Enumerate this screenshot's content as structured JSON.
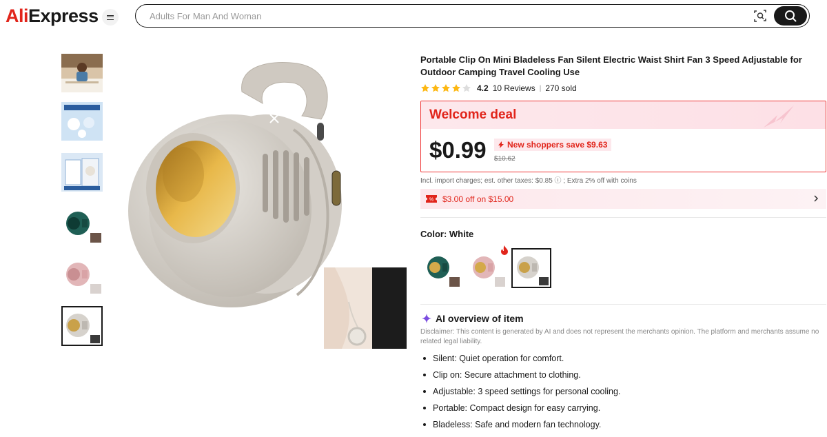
{
  "header": {
    "logo_prefix": "Ali",
    "logo_suffix": "Express",
    "search_placeholder": "Adults For Man And Woman"
  },
  "gallery": {
    "thumbnails": [
      {
        "name": "thumb-woman-at-desk",
        "selected": false
      },
      {
        "name": "thumb-infographic",
        "selected": false
      },
      {
        "name": "thumb-package",
        "selected": false
      },
      {
        "name": "thumb-green-fan",
        "selected": false
      },
      {
        "name": "thumb-pink-fan",
        "selected": false
      },
      {
        "name": "thumb-white-fan",
        "selected": true
      }
    ]
  },
  "product": {
    "title": "Portable Clip On Mini Bladeless Fan Silent Electric Waist Shirt Fan 3 Speed Adjustable for Outdoor Camping Travel Cooling Use",
    "rating": "4.2",
    "reviews": "10 Reviews",
    "separator": "|",
    "sold": "270 sold",
    "stars_filled": 4,
    "stars_total": 5
  },
  "deal": {
    "title": "Welcome deal",
    "price": "$0.99",
    "save_text": "New shoppers save $9.63",
    "original_price": "$10.62"
  },
  "tax_line": "Incl. import charges; est. other taxes: $0.85 ⓘ ; Extra 2% off with coins",
  "coupon": {
    "text": "$3.00 off on $15.00"
  },
  "color": {
    "label": "Color: White",
    "options": [
      {
        "name": "Green",
        "selected": false
      },
      {
        "name": "Pink",
        "selected": false,
        "hot": true
      },
      {
        "name": "White",
        "selected": true
      }
    ]
  },
  "ai_overview": {
    "heading": "AI overview of item",
    "disclaimer": "Disclaimer: This content is generated by AI and does not represent the merchants opinion. The platform and merchants assume no related legal liability.",
    "bullets": [
      "Silent: Quiet operation for comfort.",
      "Clip on: Secure attachment to clothing.",
      "Adjustable: 3 speed settings for personal cooling.",
      "Portable: Compact design for easy carrying.",
      "Bladeless: Safe and modern fan technology."
    ]
  },
  "colors": {
    "accent": "#e1251b",
    "star": "#fdb813",
    "deal_bg": "#fde8ec",
    "text": "#191919"
  }
}
